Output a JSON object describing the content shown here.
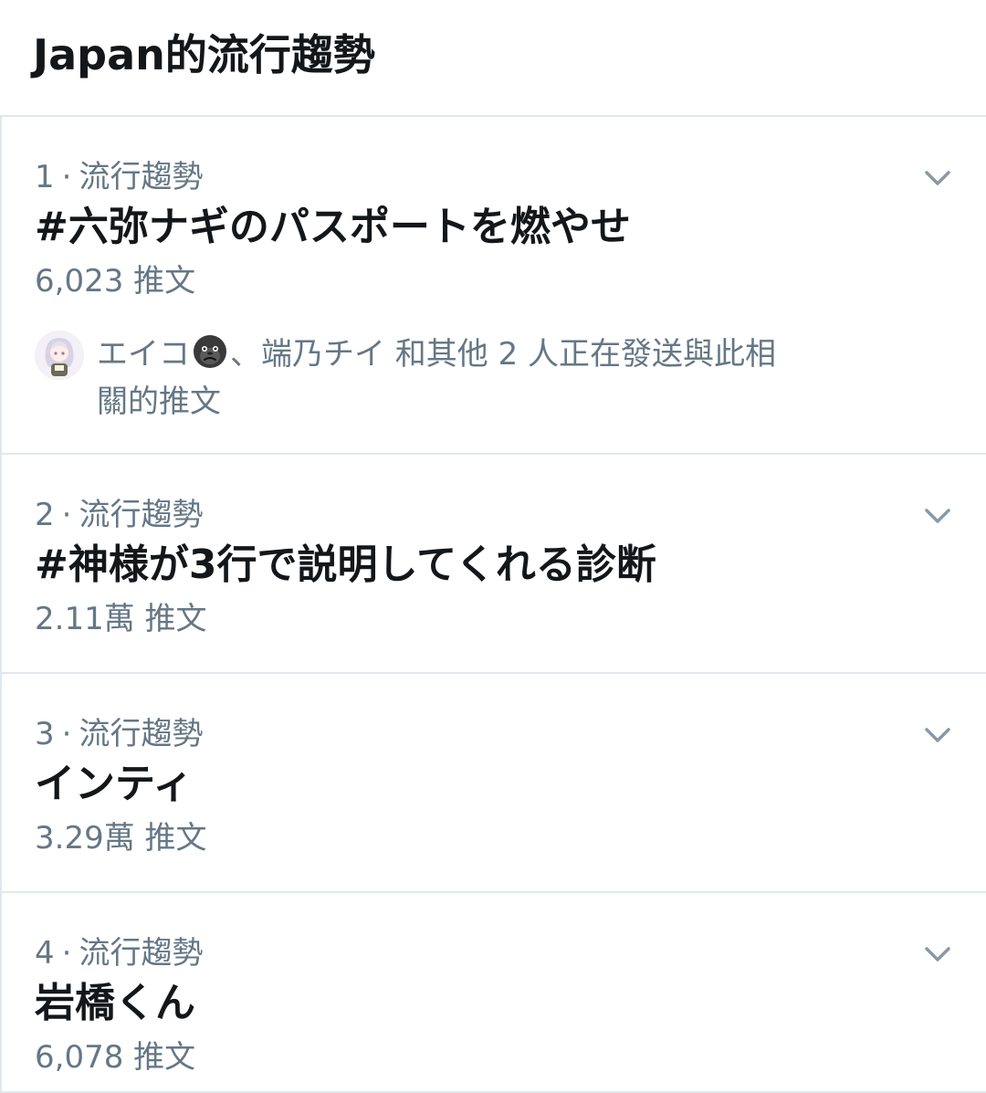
{
  "header": {
    "title": "Japan的流行趨勢"
  },
  "trends": [
    {
      "rank": "1",
      "separator": "·",
      "category": "流行趨勢",
      "name": "#六弥ナギのパスポートを燃やせ",
      "count": "6,023 推文",
      "social": {
        "user1": "エイコ",
        "emoji": "gorilla-emoji",
        "rest": "、端乃チイ 和其他 2 人正在發送與此相關的推文"
      }
    },
    {
      "rank": "2",
      "separator": "·",
      "category": "流行趨勢",
      "name": "#神様が3行で説明してくれる診断",
      "count": "2.11萬 推文"
    },
    {
      "rank": "3",
      "separator": "·",
      "category": "流行趨勢",
      "name": "インティ",
      "count": "3.29萬 推文"
    },
    {
      "rank": "4",
      "separator": "·",
      "category": "流行趨勢",
      "name": "岩橋くん",
      "count": "6,078 推文"
    }
  ],
  "icons": {
    "chevron": "chevron-down-icon",
    "avatar": "avatar"
  },
  "colors": {
    "primary_text": "#14171a",
    "secondary_text": "#657786",
    "divider": "#e1e8ed",
    "background": "#ffffff"
  }
}
